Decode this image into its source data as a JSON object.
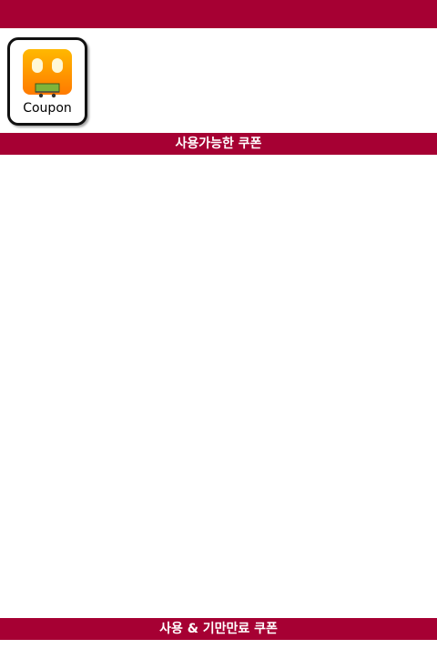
{
  "header": {
    "brand_color": "#a60033"
  },
  "logo": {
    "label": "Coupon",
    "icon": "coupon-cart-icon"
  },
  "sections": {
    "available_title": "사용가능한 쿠폰",
    "expired_title": "사용 & 기만만료 쿠폰"
  },
  "available_coupons": [],
  "expired_coupons": []
}
